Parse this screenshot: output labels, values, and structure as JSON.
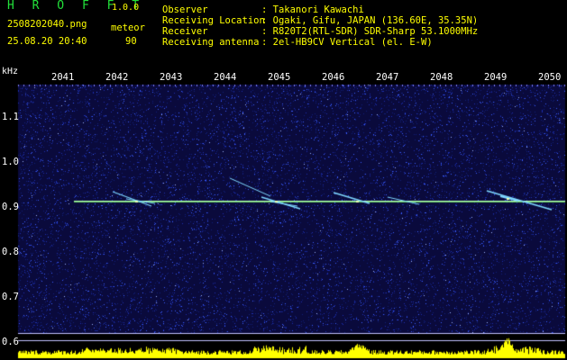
{
  "app": {
    "title": "H R O F F T",
    "version": "1.0.0"
  },
  "file": {
    "name": "2508202040.png",
    "datetime": "25.08.20 20:40"
  },
  "meteor": {
    "label": "meteor",
    "count": "90"
  },
  "info": [
    {
      "label": "Observer",
      "value": ": Takanori Kawachi"
    },
    {
      "label": "Receiving Location",
      "value": ": Ogaki, Gifu, JAPAN (136.60E, 35.35N)"
    },
    {
      "label": "Receiver",
      "value": ": R820T2(RTL-SDR) SDR-Sharp 53.1000MHz"
    },
    {
      "label": "Receiving antenna",
      "value": ": 2el-HB9CV Vertical (el. E-W)"
    }
  ],
  "axis": {
    "freq_unit": "kHz",
    "time_ticks": [
      "2041",
      "2042",
      "2043",
      "2044",
      "2045",
      "2046",
      "2047",
      "2048",
      "2049",
      "2050"
    ],
    "freq_ticks": [
      "1.1",
      "1.0",
      "0.9",
      "0.8",
      "0.7",
      "0.6"
    ]
  },
  "colors": {
    "background": "#000000",
    "noise_dark": "#0a0a3c",
    "noise_light": "#3a5cff",
    "trace": "#b8ffb8",
    "echo": "#7fd8ff",
    "activity_bar": "#ffff00",
    "title_green": "#22e03a",
    "label_yellow": "#ffff00"
  }
}
